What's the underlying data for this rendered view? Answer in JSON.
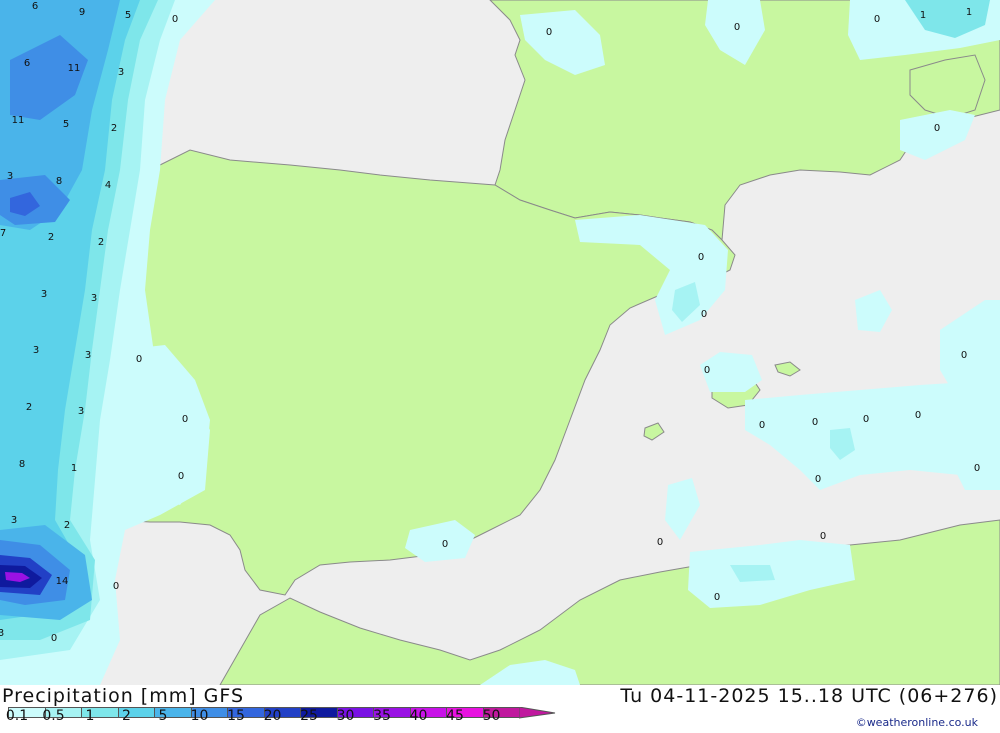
{
  "header": {
    "title": "Precipitation [mm] GFS",
    "datetime": "Tu 04-11-2025 15..18 UTC (06+276)",
    "credit": "©weatheronline.co.uk"
  },
  "legend": {
    "items": [
      {
        "label": "0.1",
        "color": "#ccfcfc"
      },
      {
        "label": "0.5",
        "color": "#a6f3f3"
      },
      {
        "label": "1",
        "color": "#7ee6ea"
      },
      {
        "label": "2",
        "color": "#5cd2ea"
      },
      {
        "label": "5",
        "color": "#4ab4ea"
      },
      {
        "label": "10",
        "color": "#3f8ee6"
      },
      {
        "label": "15",
        "color": "#3366dd"
      },
      {
        "label": "20",
        "color": "#2240c6"
      },
      {
        "label": "25",
        "color": "#0f1a9e"
      },
      {
        "label": "30",
        "color": "#7a12e4"
      },
      {
        "label": "35",
        "color": "#9a12e4"
      },
      {
        "label": "40",
        "color": "#c812e8"
      },
      {
        "label": "45",
        "color": "#e812e0"
      },
      {
        "label": "50",
        "color": "#c0189e"
      }
    ]
  },
  "colors": {
    "sea": "#eeeeee",
    "land": "#c8f7a0",
    "coast": "#8a8a8a"
  },
  "map_labels": [
    {
      "text": "6"
    },
    {
      "text": "9"
    },
    {
      "text": "5"
    },
    {
      "text": "0"
    },
    {
      "text": "6"
    },
    {
      "text": "11"
    },
    {
      "text": "3"
    },
    {
      "text": "11"
    },
    {
      "text": "5"
    },
    {
      "text": "2"
    },
    {
      "text": "3"
    },
    {
      "text": "8"
    },
    {
      "text": "4"
    },
    {
      "text": "7"
    },
    {
      "text": "2"
    },
    {
      "text": "2"
    },
    {
      "text": "3"
    },
    {
      "text": "3"
    },
    {
      "text": "3"
    },
    {
      "text": "3"
    },
    {
      "text": "0"
    },
    {
      "text": "2"
    },
    {
      "text": "3"
    },
    {
      "text": "0"
    },
    {
      "text": "8"
    },
    {
      "text": "1"
    },
    {
      "text": "0"
    },
    {
      "text": "3"
    },
    {
      "text": "2"
    },
    {
      "text": "0"
    },
    {
      "text": "14"
    },
    {
      "text": "0"
    },
    {
      "text": "3"
    },
    {
      "text": "0"
    },
    {
      "text": "0"
    },
    {
      "text": "0"
    },
    {
      "text": "0"
    },
    {
      "text": "1"
    },
    {
      "text": "1"
    },
    {
      "text": "0"
    },
    {
      "text": "0"
    },
    {
      "text": "0"
    },
    {
      "text": "0"
    },
    {
      "text": "0"
    },
    {
      "text": "0"
    },
    {
      "text": "0"
    },
    {
      "text": "0"
    },
    {
      "text": "0"
    },
    {
      "text": "0"
    },
    {
      "text": "0"
    },
    {
      "text": "0"
    },
    {
      "text": "0"
    },
    {
      "text": "0"
    }
  ]
}
